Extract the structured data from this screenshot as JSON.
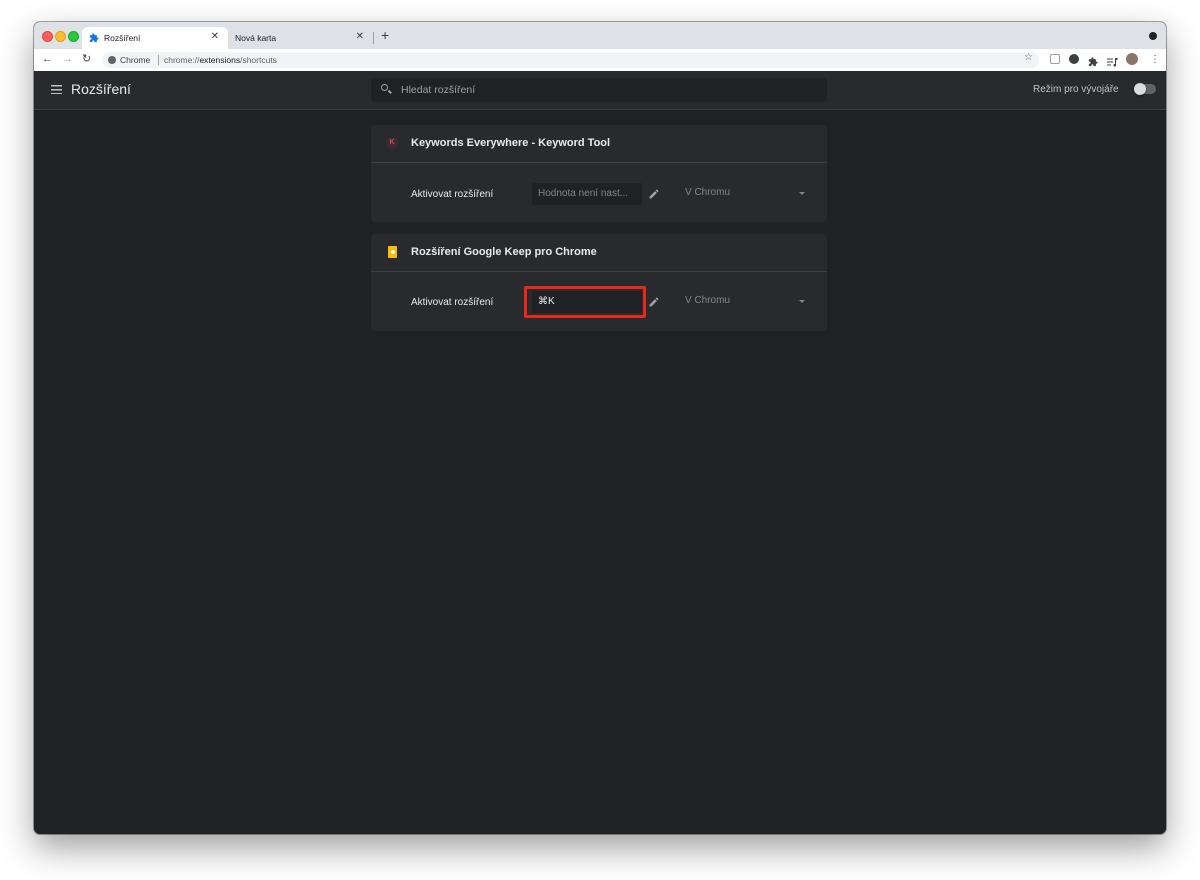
{
  "browser": {
    "tabs": [
      {
        "title": "Rozšíření",
        "active": true,
        "favicon": "puzzle-icon"
      },
      {
        "title": "Nová karta",
        "active": false
      }
    ],
    "omnibox": {
      "site_label": "Chrome",
      "url_prefix": "chrome://",
      "url_host": "extensions",
      "url_path": "/shortcuts"
    }
  },
  "header": {
    "title": "Rozšíření",
    "search_placeholder": "Hledat rozšíření",
    "developer_mode_label": "Režim pro vývojáře",
    "developer_mode_on": false
  },
  "extensions": [
    {
      "name": "Keywords Everywhere - Keyword Tool",
      "icon": "keywords-everywhere-icon",
      "icon_letter": "K",
      "shortcut_label": "Aktivovat rozšíření",
      "shortcut_value": "",
      "shortcut_placeholder": "Hodnota není nast...",
      "scope": "V Chromu"
    },
    {
      "name": "Rozšíření Google Keep pro Chrome",
      "icon": "google-keep-icon",
      "shortcut_label": "Aktivovat rozšíření",
      "shortcut_value": "⌘K",
      "scope": "V Chromu",
      "highlighted": true
    }
  ],
  "colors": {
    "page_bg": "#202124",
    "card_bg": "#292a2d",
    "highlight": "#e8281a",
    "keep_yellow": "#fbbc04"
  }
}
